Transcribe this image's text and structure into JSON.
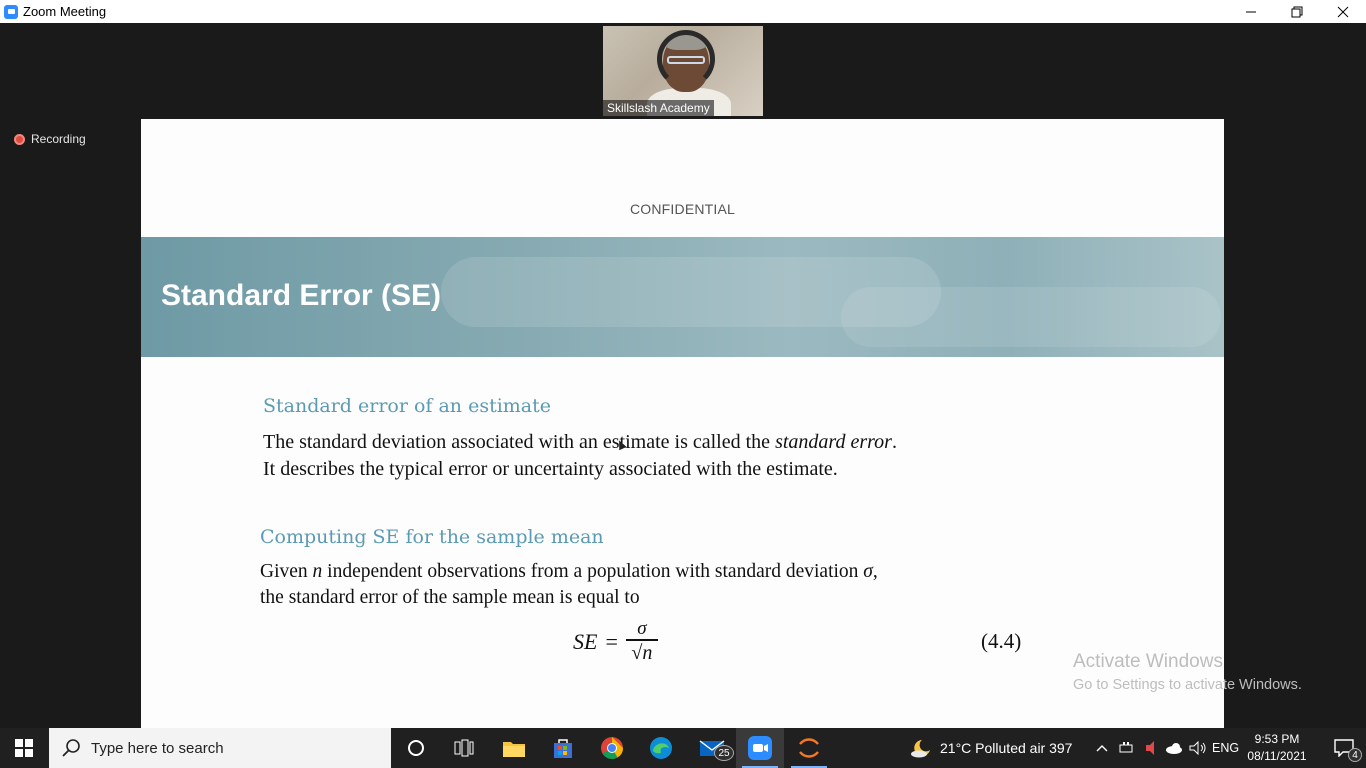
{
  "window": {
    "title": "Zoom Meeting",
    "controls": {
      "minimize": "minimize",
      "restore": "restore",
      "close": "close"
    }
  },
  "meeting": {
    "participant_name": "Skillslash Academy",
    "recording_label": "Recording"
  },
  "slide": {
    "confidential": "CONFIDENTIAL",
    "title": "Standard Error (SE)",
    "section1_heading": "Standard error of an estimate",
    "section1_line1_a": "The standard deviation associated with an estimate is called the ",
    "section1_line1_em": "standard error",
    "section1_line1_b": ".",
    "section1_line2": "It describes the typical error or uncertainty associated with the estimate.",
    "section2_heading": "Computing SE for the sample mean",
    "section2_line1_a": "Given ",
    "section2_line1_n": "n",
    "section2_line1_b": " independent observations from a population with standard deviation ",
    "section2_line1_sigma": "σ",
    "section2_line1_c": ",",
    "section2_line2": "the standard error of the sample mean is equal to",
    "formula_lhs": "SE",
    "formula_eq": "=",
    "formula_num": "σ",
    "formula_den": "√n",
    "equation_number": "(4.4)"
  },
  "watermark": {
    "line1": "Activate Windows",
    "line2": "Go to Settings to activate Windows."
  },
  "taskbar": {
    "search_placeholder": "Type here to search",
    "mail_badge": "25",
    "weather": "21°C  Polluted air 397",
    "language": "ENG",
    "time": "9:53 PM",
    "date": "08/11/2021",
    "notification_count": "4"
  },
  "colors": {
    "heading_blue": "#5b9ab4",
    "banner": "#87aab2",
    "zoom_blue": "#2d8cff",
    "recording_red": "#e04a3f"
  }
}
